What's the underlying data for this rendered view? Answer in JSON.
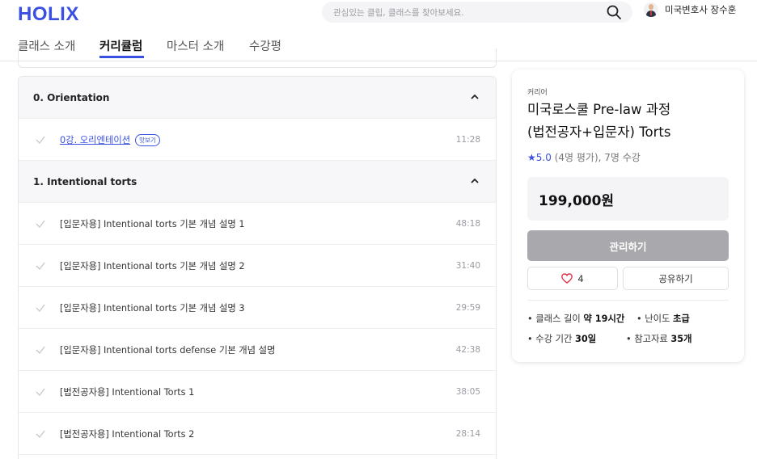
{
  "header": {
    "logo": "HOLIX",
    "search_placeholder": "관심있는 클립, 클래스를 찾아보세요.",
    "user_name": "미국변호사 장수훈"
  },
  "tabs": [
    {
      "label": "클래스 소개",
      "active": false
    },
    {
      "label": "커리큘럼",
      "active": true
    },
    {
      "label": "마스터 소개",
      "active": false
    },
    {
      "label": "수강평",
      "active": false
    }
  ],
  "curriculum": {
    "sections": [
      {
        "title": "0. Orientation",
        "lessons": [
          {
            "title": "0강. 오리엔테이션",
            "badge": "맛보기",
            "time": "11:28"
          }
        ]
      },
      {
        "title": "1. Intentional torts",
        "lessons": [
          {
            "title": "[입문자용] Intentional torts 기본 개념 설명 1",
            "time": "48:18"
          },
          {
            "title": "[입문자용] Intentional torts 기본 개념 설명 2",
            "time": "31:40"
          },
          {
            "title": "[입문자용] Intentional torts 기본 개념 설명 3",
            "time": "29:59"
          },
          {
            "title": "[입문자용] Intentional torts defense 기본 개념 설명",
            "time": "42:38"
          },
          {
            "title": "[법전공자용] Intentional Torts 1",
            "time": "38:05"
          },
          {
            "title": "[법전공자용] Intentional Torts 2",
            "time": "28:14"
          }
        ]
      }
    ]
  },
  "course": {
    "category": "커리어",
    "title_line1": "미국로스쿨 Pre-law 과정",
    "title_line2": "(법전공자+입문자) Torts",
    "rating_star": "★",
    "rating_score": "5.0",
    "rating_detail": "(4명 평가), 7명 수강",
    "price": "199,000원",
    "manage_label": "관리하기",
    "like_count": "4",
    "share_label": "공유하기",
    "info": {
      "length_label": "• 클래스 길이 ",
      "length_value": "약 19시간",
      "difficulty_label": "• 난이도 ",
      "difficulty_value": "초급",
      "period_label": "• 수강 기간 ",
      "period_value": "30일",
      "materials_label": "• 참고자료 ",
      "materials_value": "35개"
    }
  },
  "colors": {
    "accent": "#3a50e0",
    "button_disabled": "#a9a9ad",
    "heart": "#e0334a"
  },
  "icons": [
    "search-icon",
    "chevron-up-icon",
    "check-icon",
    "heart-icon"
  ]
}
